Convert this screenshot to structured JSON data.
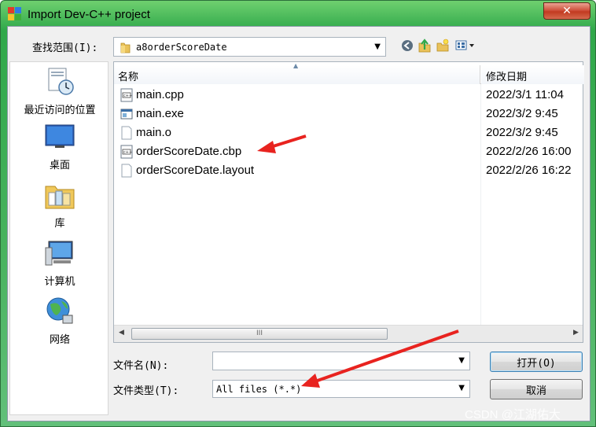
{
  "window": {
    "title": "Import Dev-C++ project",
    "close_label": "✕"
  },
  "toolbar": {
    "lookin_label": "查找范围(I):",
    "lookin_value": "a8orderScoreDate",
    "back_icon": "back-arrow-icon",
    "up_icon": "up-folder-icon",
    "new_folder_icon": "new-folder-icon",
    "view_menu_icon": "view-menu-icon"
  },
  "places": [
    {
      "label": "最近访问的位置",
      "icon": "recent-places-icon"
    },
    {
      "label": "桌面",
      "icon": "desktop-icon"
    },
    {
      "label": "库",
      "icon": "libraries-icon"
    },
    {
      "label": "计算机",
      "icon": "computer-icon"
    },
    {
      "label": "网络",
      "icon": "network-icon"
    }
  ],
  "filelist": {
    "columns": [
      "名称",
      "修改日期"
    ],
    "files": [
      {
        "name": "main.cpp",
        "date": "2022/3/1 11:04",
        "icon": "cpp-file-icon"
      },
      {
        "name": "main.exe",
        "date": "2022/3/2 9:45",
        "icon": "exe-file-icon"
      },
      {
        "name": "main.o",
        "date": "2022/3/2 9:45",
        "icon": "blank-file-icon"
      },
      {
        "name": "orderScoreDate.cbp",
        "date": "2022/2/26 16:00",
        "icon": "cbp-file-icon"
      },
      {
        "name": "orderScoreDate.layout",
        "date": "2022/2/26 16:22",
        "icon": "blank-file-icon"
      }
    ],
    "scroll_thumb_grip": "III"
  },
  "form": {
    "filename_label": "文件名(N):",
    "filename_value": "",
    "filetype_label": "文件类型(T):",
    "filetype_value": "All files (*.*)"
  },
  "buttons": {
    "open": "打开(O)",
    "cancel": "取消"
  },
  "watermark": "CSDN @江湖佑大",
  "colors": {
    "title_bar": "#2fa84a",
    "annotation_arrow": "#e8231f",
    "dialog_bg": "#f0f0f0"
  }
}
